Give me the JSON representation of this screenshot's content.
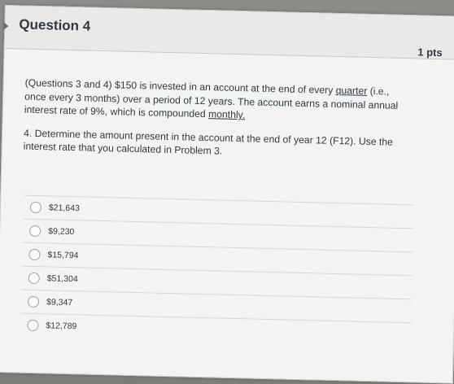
{
  "question": {
    "title": "Question 4",
    "points": "1 pts",
    "para1": {
      "line1_pre": "(Questions 3 and 4) $150 is invested in an account at the end of every ",
      "line1_u": "quarter",
      "line1_post": " (i.e.,",
      "line2": "once every 3 months) over a period of 12 years. The account earns a nominal annual",
      "line3_pre": "interest rate of 9%, which is compounded ",
      "line3_u": "monthly."
    },
    "para2": {
      "line1": "4. Determine the amount present in the account at the end of year 12 (F12). Use the",
      "line2": "interest rate that you calculated in Problem 3."
    }
  },
  "answers": [
    {
      "label": "$21,643"
    },
    {
      "label": "$9,230"
    },
    {
      "label": "$15,794"
    },
    {
      "label": "$51,304"
    },
    {
      "label": "$9,347"
    },
    {
      "label": "$12,789"
    }
  ]
}
